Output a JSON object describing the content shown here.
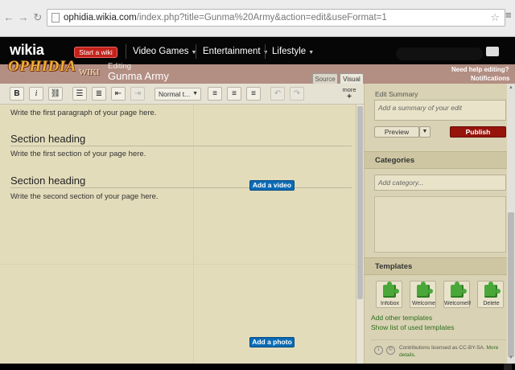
{
  "browser": {
    "url_host": "ophidia.wikia.com",
    "url_path": "/index.php?title=Gunma%20Army&action=edit&useFormat=1"
  },
  "global_nav": {
    "logo": "wikia",
    "start_wiki": "Start a wiki",
    "items": [
      "Video Games",
      "Entertainment",
      "Lifestyle"
    ]
  },
  "wiki_header": {
    "logo": "OPHIDIA",
    "logo_suffix": "WIKI",
    "editing_label": "Editing",
    "page_title": "Gunma Army",
    "tab_source": "Source",
    "tab_visual": "Visual",
    "help": "Need help editing?",
    "notifications": "Notifications"
  },
  "toolbar": {
    "bold": "B",
    "italic": "i",
    "format_value": "Normal t...",
    "more": "more"
  },
  "editor": {
    "para1": "Write the first paragraph of your page here.",
    "heading1": "Section heading",
    "para2": "Write the first section of your page here.",
    "heading2": "Section heading",
    "para3": "Write the second section of your page here.",
    "add_video": "Add a video",
    "add_photo": "Add a photo"
  },
  "rail": {
    "summary_label": "Edit Summary",
    "summary_placeholder": "Add a summary of your edit",
    "preview": "Preview",
    "publish": "Publish",
    "categories_heading": "Categories",
    "category_placeholder": "Add category...",
    "templates_heading": "Templates",
    "templates": [
      "Infobox",
      "Welcome",
      "WelcomeIP",
      "Delete"
    ],
    "add_other_templates": "Add other templates",
    "show_used_templates": "Show list of used templates",
    "license_text": "Contributions licensed as CC-BY-SA.",
    "license_more": "More details."
  },
  "colors": {
    "publish": "#96140c",
    "media_button": "#0a6bb5",
    "editor_bg": "#e3dcbb",
    "start_wiki": "#c3221a"
  }
}
